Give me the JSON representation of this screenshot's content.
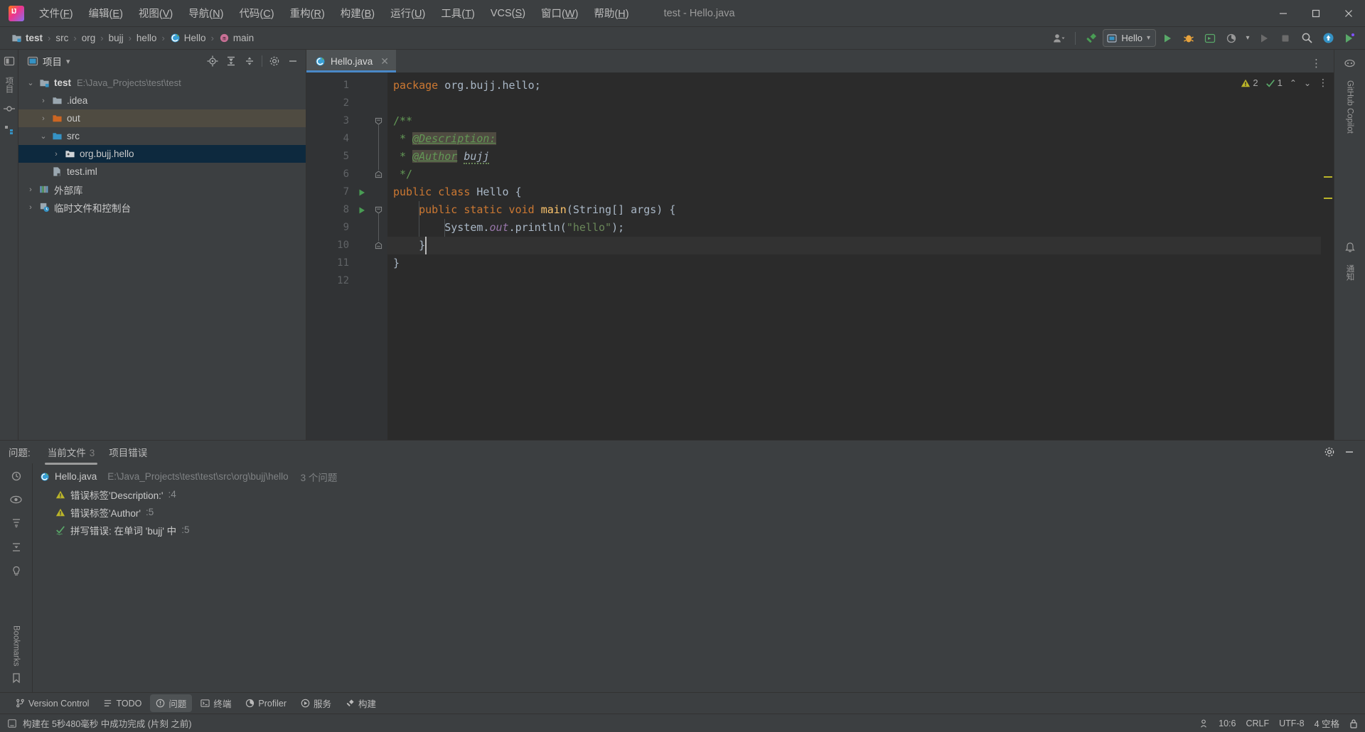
{
  "window": {
    "title": "test - Hello.java",
    "logo": "intellij-idea-logo",
    "minimize": "—",
    "maximize": "❐",
    "close": "✕"
  },
  "menubar": {
    "items": [
      {
        "label": "文件",
        "mnemonic": "F"
      },
      {
        "label": "编辑",
        "mnemonic": "E"
      },
      {
        "label": "视图",
        "mnemonic": "V"
      },
      {
        "label": "导航",
        "mnemonic": "N"
      },
      {
        "label": "代码",
        "mnemonic": "C"
      },
      {
        "label": "重构",
        "mnemonic": "R"
      },
      {
        "label": "构建",
        "mnemonic": "B"
      },
      {
        "label": "运行",
        "mnemonic": "U"
      },
      {
        "label": "工具",
        "mnemonic": "T"
      },
      {
        "label": "VCS",
        "mnemonic": "S"
      },
      {
        "label": "窗口",
        "mnemonic": "W"
      },
      {
        "label": "帮助",
        "mnemonic": "H"
      }
    ]
  },
  "navbar": {
    "breadcrumbs": [
      {
        "label": "test",
        "icon": "project-icon",
        "bold": true
      },
      {
        "label": "src",
        "icon": "folder-icon",
        "bold": false
      },
      {
        "label": "org",
        "icon": "folder-icon",
        "bold": false
      },
      {
        "label": "bujj",
        "icon": "folder-icon",
        "bold": false
      },
      {
        "label": "hello",
        "icon": "folder-icon",
        "bold": false
      },
      {
        "label": "Hello",
        "icon": "java-class-icon",
        "bold": false
      },
      {
        "label": "main",
        "icon": "method-icon",
        "bold": false
      }
    ],
    "separator": "›",
    "run_config": "Hello",
    "actions": [
      "user-avatar-icon",
      "build-hammer-icon",
      "run-icon",
      "debug-icon",
      "run-with-coverage-icon",
      "profiler-icon",
      "run-selected-icon",
      "stop-icon",
      "search-everywhere-icon",
      "updates-icon",
      "ai-assistant-icon"
    ]
  },
  "left_stripe": {
    "top_icons": [
      "project-tool-icon",
      "commit-tool-icon",
      "structure-tool-icon"
    ],
    "label": "项目"
  },
  "project_panel": {
    "title": "项目",
    "icon": "project-view-icon",
    "dropdown": "▾",
    "actions": [
      "select-opened-file-icon",
      "expand-all-icon",
      "collapse-all-icon",
      "settings-gear-icon",
      "hide-panel-icon"
    ],
    "tree": [
      {
        "label": "test",
        "path": "E:\\Java_Projects\\test\\test",
        "icon": "module-icon",
        "indent": 0,
        "arrow": "down",
        "state": "normal",
        "bold": true
      },
      {
        "label": ".idea",
        "path": "",
        "icon": "folder-icon",
        "indent": 1,
        "arrow": "right",
        "state": "normal",
        "bold": false
      },
      {
        "label": "out",
        "path": "",
        "icon": "folder-excluded-icon",
        "indent": 1,
        "arrow": "right",
        "state": "highlight",
        "bold": false
      },
      {
        "label": "src",
        "path": "",
        "icon": "source-folder-icon",
        "indent": 1,
        "arrow": "down",
        "state": "normal",
        "bold": false
      },
      {
        "label": "org.bujj.hello",
        "path": "",
        "icon": "package-icon",
        "indent": 2,
        "arrow": "right",
        "state": "selected",
        "bold": false
      },
      {
        "label": "test.iml",
        "path": "",
        "icon": "iml-file-icon",
        "indent": 1,
        "arrow": "none",
        "state": "normal",
        "bold": false
      },
      {
        "label": "外部库",
        "path": "",
        "icon": "external-libraries-icon",
        "indent": 0,
        "arrow": "right",
        "state": "normal",
        "bold": false
      },
      {
        "label": "临时文件和控制台",
        "path": "",
        "icon": "scratches-icon",
        "indent": 0,
        "arrow": "right",
        "state": "normal",
        "bold": false
      }
    ]
  },
  "editor": {
    "tab": {
      "label": "Hello.java",
      "icon": "java-class-icon",
      "close": "✕"
    },
    "inspection": {
      "warning_icon": "warning-triangle-icon",
      "warning_count": "2",
      "typo_icon": "typo-check-icon",
      "typo_count": "1",
      "up_arrow": "⌃",
      "down_arrow": "⌄",
      "more": "⋮"
    },
    "line_numbers": [
      "1",
      "2",
      "3",
      "4",
      "5",
      "6",
      "7",
      "8",
      "9",
      "10",
      "11",
      "12"
    ],
    "current_line": 10,
    "run_markers": [
      7,
      8
    ],
    "lines": [
      {
        "n": 1,
        "tokens": [
          {
            "t": "kw",
            "v": "package"
          },
          {
            "t": "plain",
            "v": " org.bujj.hello"
          },
          {
            "t": "plain",
            "v": ";"
          }
        ]
      },
      {
        "n": 2,
        "tokens": []
      },
      {
        "n": 3,
        "tokens": [
          {
            "t": "cmt",
            "v": "/**"
          }
        ]
      },
      {
        "n": 4,
        "tokens": [
          {
            "t": "cmt",
            "v": " * "
          },
          {
            "t": "tag",
            "v": "@Description:"
          }
        ]
      },
      {
        "n": 5,
        "tokens": [
          {
            "t": "cmt",
            "v": " * "
          },
          {
            "t": "tag",
            "v": "@Author"
          },
          {
            "t": "plain",
            "v": " "
          },
          {
            "t": "tagval",
            "v": "bujj"
          }
        ]
      },
      {
        "n": 6,
        "tokens": [
          {
            "t": "cmt",
            "v": " */"
          }
        ]
      },
      {
        "n": 7,
        "tokens": [
          {
            "t": "kw",
            "v": "public class "
          },
          {
            "t": "cls",
            "v": "Hello"
          },
          {
            "t": "plain",
            "v": " {"
          }
        ]
      },
      {
        "n": 8,
        "tokens": [
          {
            "t": "plain",
            "v": "    "
          },
          {
            "t": "kw",
            "v": "public static void "
          },
          {
            "t": "ident",
            "v": "main"
          },
          {
            "t": "plain",
            "v": "("
          },
          {
            "t": "cls",
            "v": "String"
          },
          {
            "t": "plain",
            "v": "[] args) "
          },
          {
            "t": "brace",
            "v": "{"
          }
        ]
      },
      {
        "n": 9,
        "tokens": [
          {
            "t": "plain",
            "v": "        System."
          },
          {
            "t": "fld",
            "v": "out"
          },
          {
            "t": "plain",
            "v": ".println("
          },
          {
            "t": "str",
            "v": "\"hello\""
          },
          {
            "t": "plain",
            "v": ");"
          }
        ]
      },
      {
        "n": 10,
        "tokens": [
          {
            "t": "plain",
            "v": "    "
          },
          {
            "t": "brace",
            "v": "}"
          }
        ]
      },
      {
        "n": 11,
        "tokens": [
          {
            "t": "plain",
            "v": "}"
          }
        ]
      },
      {
        "n": 12,
        "tokens": []
      }
    ]
  },
  "right_stripe": {
    "top_label": "GitHub Copilot",
    "bottom_label": "通知"
  },
  "problems": {
    "title": "问题:",
    "tabs": [
      {
        "label": "当前文件",
        "count": "3",
        "active": true
      },
      {
        "label": "项目错误",
        "count": "",
        "active": false
      }
    ],
    "actions": [
      "settings-gear-icon",
      "hide-panel-icon"
    ],
    "file": {
      "name": "Hello.java",
      "icon": "java-class-icon",
      "path": "E:\\Java_Projects\\test\\test\\src\\org\\bujj\\hello",
      "count": "3 个问题"
    },
    "items": [
      {
        "icon": "warning-triangle-icon",
        "text": "错误标签'Description:'",
        "line": ":4"
      },
      {
        "icon": "warning-triangle-icon",
        "text": "错误标签'Author'",
        "line": ":5"
      },
      {
        "icon": "typo-check-icon",
        "text": "拼写错误: 在单词 'bujj' 中",
        "line": ":5"
      }
    ],
    "stripe_icons": [
      "analyze-icon",
      "preview-icon",
      "sort-severity-icon",
      "expand-icon",
      "inspection-icon"
    ],
    "bookmarks_label": "Bookmarks",
    "bookmarks_icon": "bookmark-icon"
  },
  "bottom_toolbar": {
    "buttons": [
      {
        "label": "Version Control",
        "icon": "branch-icon",
        "active": false
      },
      {
        "label": "TODO",
        "icon": "todo-icon",
        "active": false
      },
      {
        "label": "问题",
        "icon": "problems-icon",
        "active": true
      },
      {
        "label": "终端",
        "icon": "terminal-icon",
        "active": false
      },
      {
        "label": "Profiler",
        "icon": "profiler-icon",
        "active": false
      },
      {
        "label": "服务",
        "icon": "services-icon",
        "active": false
      },
      {
        "label": "构建",
        "icon": "build-hammer-icon",
        "active": false
      }
    ]
  },
  "statusbar": {
    "icon": "build-status-icon",
    "message": "构建在 5秒480毫秒 中成功完成 (片刻 之前)",
    "right": [
      {
        "name": "indent-icon",
        "label": ""
      },
      {
        "name": "caret-position",
        "label": "10:6"
      },
      {
        "name": "line-separator",
        "label": "CRLF"
      },
      {
        "name": "file-encoding",
        "label": "UTF-8"
      },
      {
        "name": "indent-size",
        "label": "4 空格"
      },
      {
        "name": "lock-icon",
        "label": ""
      }
    ]
  },
  "colors": {
    "bg": "#3c3f41",
    "editor_bg": "#2b2b2b",
    "gutter_bg": "#313335",
    "selection": "#0d293e",
    "accent": "#4a88c7",
    "warning": "#bbb529",
    "keyword": "#cc7832",
    "string": "#6a8759",
    "comment": "#629755"
  }
}
